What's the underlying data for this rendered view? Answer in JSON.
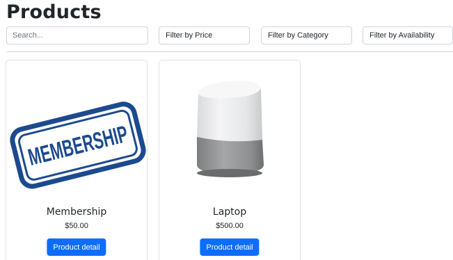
{
  "page": {
    "title": "Products"
  },
  "filters": {
    "search_placeholder": "Search...",
    "price_label": "Filter by Price",
    "category_label": "Filter by Category",
    "availability_label": "Filter by Availability"
  },
  "products": [
    {
      "name": "Membership",
      "price": "$50.00",
      "button_label": "Product detail",
      "image": "membership-stamp-image"
    },
    {
      "name": "Laptop",
      "price": "$500.00",
      "button_label": "Product detail",
      "image": "smart-speaker-image"
    }
  ],
  "colors": {
    "primary_button": "#0d6efd",
    "stamp_blue": "#1c4a8f"
  }
}
